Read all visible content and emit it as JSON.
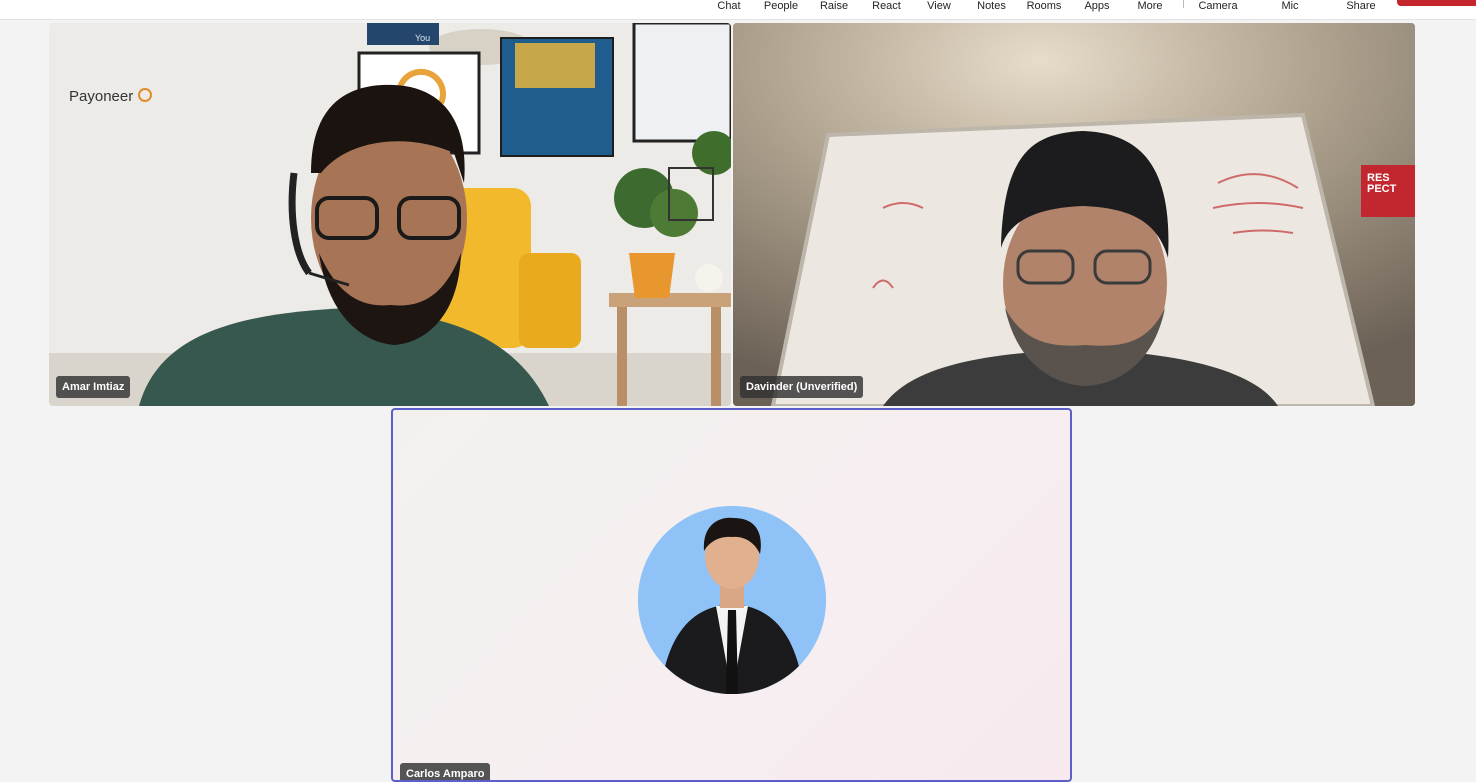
{
  "toolbar": {
    "chat": "Chat",
    "people": "People",
    "raise": "Raise",
    "react": "React",
    "view": "View",
    "notes": "Notes",
    "rooms": "Rooms",
    "apps": "Apps",
    "more": "More",
    "camera": "Camera",
    "mic": "Mic",
    "share": "Share"
  },
  "participants": {
    "p1": {
      "name": "Amar Imtiaz",
      "backdrop_logo": "Payoneer",
      "poster_text": "You"
    },
    "p2": {
      "name": "Davinder (Unverified)",
      "sign_text_line1": "RES",
      "sign_text_line2": "PECT"
    },
    "p3": {
      "name": "Carlos Amparo"
    }
  },
  "colors": {
    "active_speaker_border": "#5b5fc7",
    "leave_button": "#c4262e",
    "stage_background": "#f3f3f3"
  }
}
